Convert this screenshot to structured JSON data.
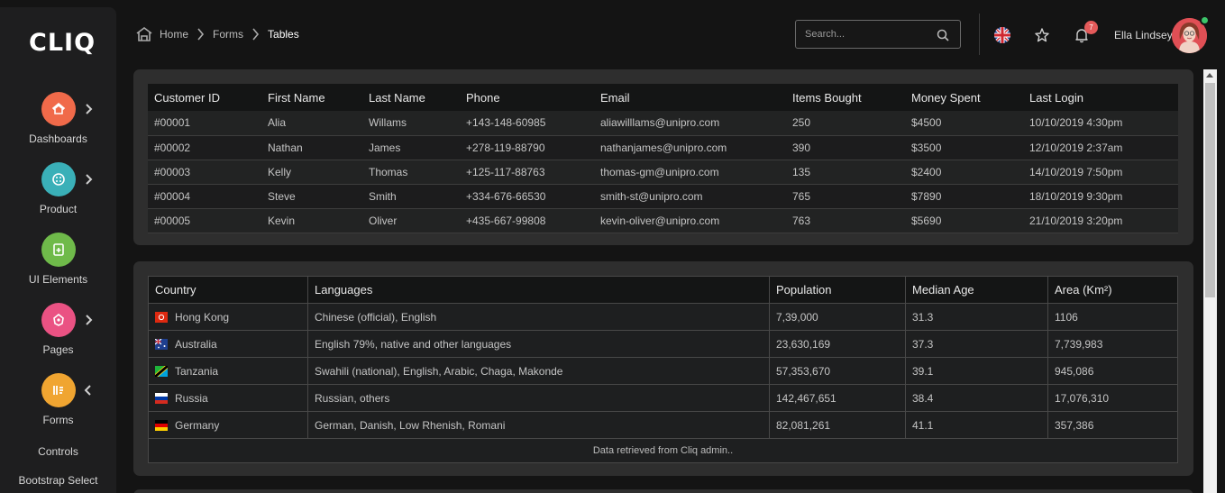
{
  "brand": {
    "logo": "CLIQ"
  },
  "sidebar": {
    "items": [
      {
        "label": "Dashboards",
        "icon": "home-icon",
        "color": "#f06a4a"
      },
      {
        "label": "Product",
        "icon": "palette-icon",
        "color": "#3ab0b8"
      },
      {
        "label": "UI Elements",
        "icon": "add-file-icon",
        "color": "#6fba4a"
      },
      {
        "label": "Pages",
        "icon": "pages-icon",
        "color": "#ea5283"
      },
      {
        "label": "Forms",
        "icon": "forms-icon",
        "color": "#f0a531"
      }
    ],
    "subitems": [
      "Controls",
      "Bootstrap Select"
    ]
  },
  "breadcrumb": {
    "home": "Home",
    "forms": "Forms",
    "current": "Tables"
  },
  "header": {
    "search_placeholder": "Search...",
    "notification_count": "7",
    "user_name": "Ella Lindsey"
  },
  "customers": {
    "columns": [
      "Customer ID",
      "First Name",
      "Last Name",
      "Phone",
      "Email",
      "Items Bought",
      "Money Spent",
      "Last Login"
    ],
    "rows": [
      [
        "#00001",
        "Alia",
        "Willams",
        "+143-148-60985",
        "aliawilllams@unipro.com",
        "250",
        "$4500",
        "10/10/2019 4:30pm"
      ],
      [
        "#00002",
        "Nathan",
        "James",
        "+278-119-88790",
        "nathanjames@unipro.com",
        "390",
        "$3500",
        "12/10/2019 2:37am"
      ],
      [
        "#00003",
        "Kelly",
        "Thomas",
        "+125-117-88763",
        "thomas-gm@unipro.com",
        "135",
        "$2400",
        "14/10/2019 7:50pm"
      ],
      [
        "#00004",
        "Steve",
        "Smith",
        "+334-676-66530",
        "smith-st@unipro.com",
        "765",
        "$7890",
        "18/10/2019 9:30pm"
      ],
      [
        "#00005",
        "Kevin",
        "Oliver",
        "+435-667-99808",
        "kevin-oliver@unipro.com",
        "763",
        "$5690",
        "21/10/2019 3:20pm"
      ]
    ]
  },
  "countries": {
    "columns": [
      "Country",
      "Languages",
      "Population",
      "Median Age",
      "Area (Km²)"
    ],
    "rows": [
      {
        "flag": "hong-kong-flag-icon",
        "cells": [
          "Hong Kong",
          "Chinese (official), English",
          "7,39,000",
          "31.3",
          "1106"
        ]
      },
      {
        "flag": "australia-flag-icon",
        "cells": [
          "Australia",
          "English 79%, native and other languages",
          "23,630,169",
          "37.3",
          "7,739,983"
        ]
      },
      {
        "flag": "tanzania-flag-icon",
        "cells": [
          "Tanzania",
          "Swahili (national), English, Arabic, Chaga, Makonde",
          "57,353,670",
          "39.1",
          "945,086"
        ]
      },
      {
        "flag": "russia-flag-icon",
        "cells": [
          "Russia",
          "Russian, others",
          "142,467,651",
          "38.4",
          "17,076,310"
        ]
      },
      {
        "flag": "germany-flag-icon",
        "cells": [
          "Germany",
          "German, Danish, Low Rhenish, Romani",
          "82,081,261",
          "41.1",
          "357,386"
        ]
      }
    ],
    "footer": "Data retrieved from Cliq admin.."
  }
}
